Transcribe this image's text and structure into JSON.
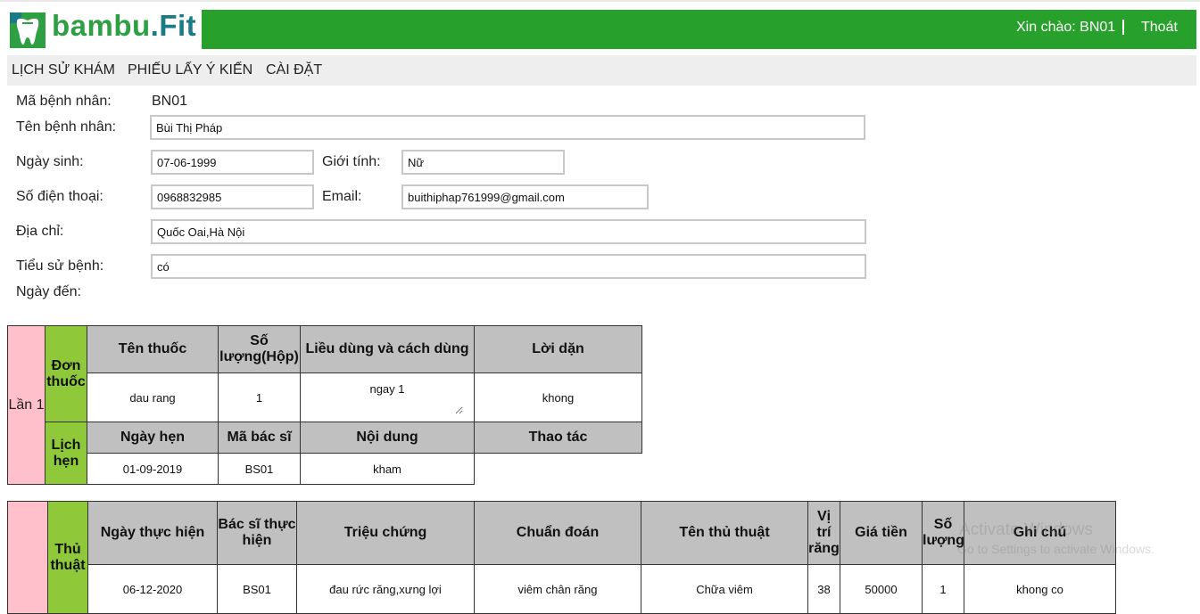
{
  "header": {
    "logo_part1": "bambu",
    "logo_part2": ".Fit",
    "greeting": "Xin chào: BN01",
    "logout_label": "Thoát",
    "colors": {
      "header_bg": "#28a12c",
      "menu_bg": "#eeeeee",
      "row_label_bg": "#ffc0cb",
      "section_label_bg": "#8fc93a",
      "table_header_bg": "#c0c0c0"
    }
  },
  "nav": {
    "items": [
      {
        "label": "LỊCH SỬ KHÁM"
      },
      {
        "label": "PHIẾU LẤY Ý KIẾN"
      },
      {
        "label": "CÀI ĐẶT"
      }
    ]
  },
  "patient": {
    "id_label": "Mã bệnh nhân:",
    "id_value": "BN01",
    "name_label": "Tên bệnh nhân:",
    "name_value": "Bùi Thị Pháp",
    "dob_label": "Ngày sinh:",
    "dob_value": "07-06-1999",
    "gender_label": "Giới tính:",
    "gender_value": "Nữ",
    "phone_label": "Số điện thoại:",
    "phone_value": "0968832985",
    "email_label": "Email:",
    "email_value": "buithiphap761999@gmail.com",
    "address_label": "Địa chỉ:",
    "address_value": "Quốc Oai,Hà Nội",
    "history_label": "Tiểu sử bệnh:",
    "history_value": "có",
    "arrival_label": "Ngày đến:"
  },
  "visit_table": {
    "visit_label": "Lần 1",
    "prescription_label": "Đơn thuốc",
    "prescription_headers": [
      "Tên thuốc",
      "Số lượng(Hộp)",
      "Liều dùng và cách dùng",
      "Lời dặn"
    ],
    "prescription_rows": [
      {
        "drug": "dau rang",
        "quantity": "1",
        "dosage": "ngay 1",
        "advice": "khong"
      }
    ],
    "appointment_label": "Lịch hẹn",
    "appointment_headers": [
      "Ngày hẹn",
      "Mã bác sĩ",
      "Nội dung",
      "Thao tác"
    ],
    "appointment_rows": [
      {
        "date": "01-09-2019",
        "doctor": "BS01",
        "content": "kham"
      }
    ]
  },
  "procedure_table": {
    "section_label": "Thủ thuật",
    "headers": [
      "Ngày thực hiện",
      "Bác sĩ thực hiện",
      "Triệu chứng",
      "Chuẩn đoán",
      "Tên thủ thuật",
      "Vị trí răng",
      "Giá tiền",
      "Số lượng",
      "Ghi chú"
    ],
    "rows": [
      {
        "date": "06-12-2020",
        "doctor": "BS01",
        "symptom": "đau rức răng,xưng lợi",
        "diagnosis": "viêm chân răng",
        "procedure": "Chữa viêm",
        "tooth": "38",
        "price": "50000",
        "quantity": "1",
        "note": "khong co"
      }
    ]
  },
  "watermark": {
    "line1": "Activate Windows",
    "line2": "Go to Settings to activate Windows."
  }
}
